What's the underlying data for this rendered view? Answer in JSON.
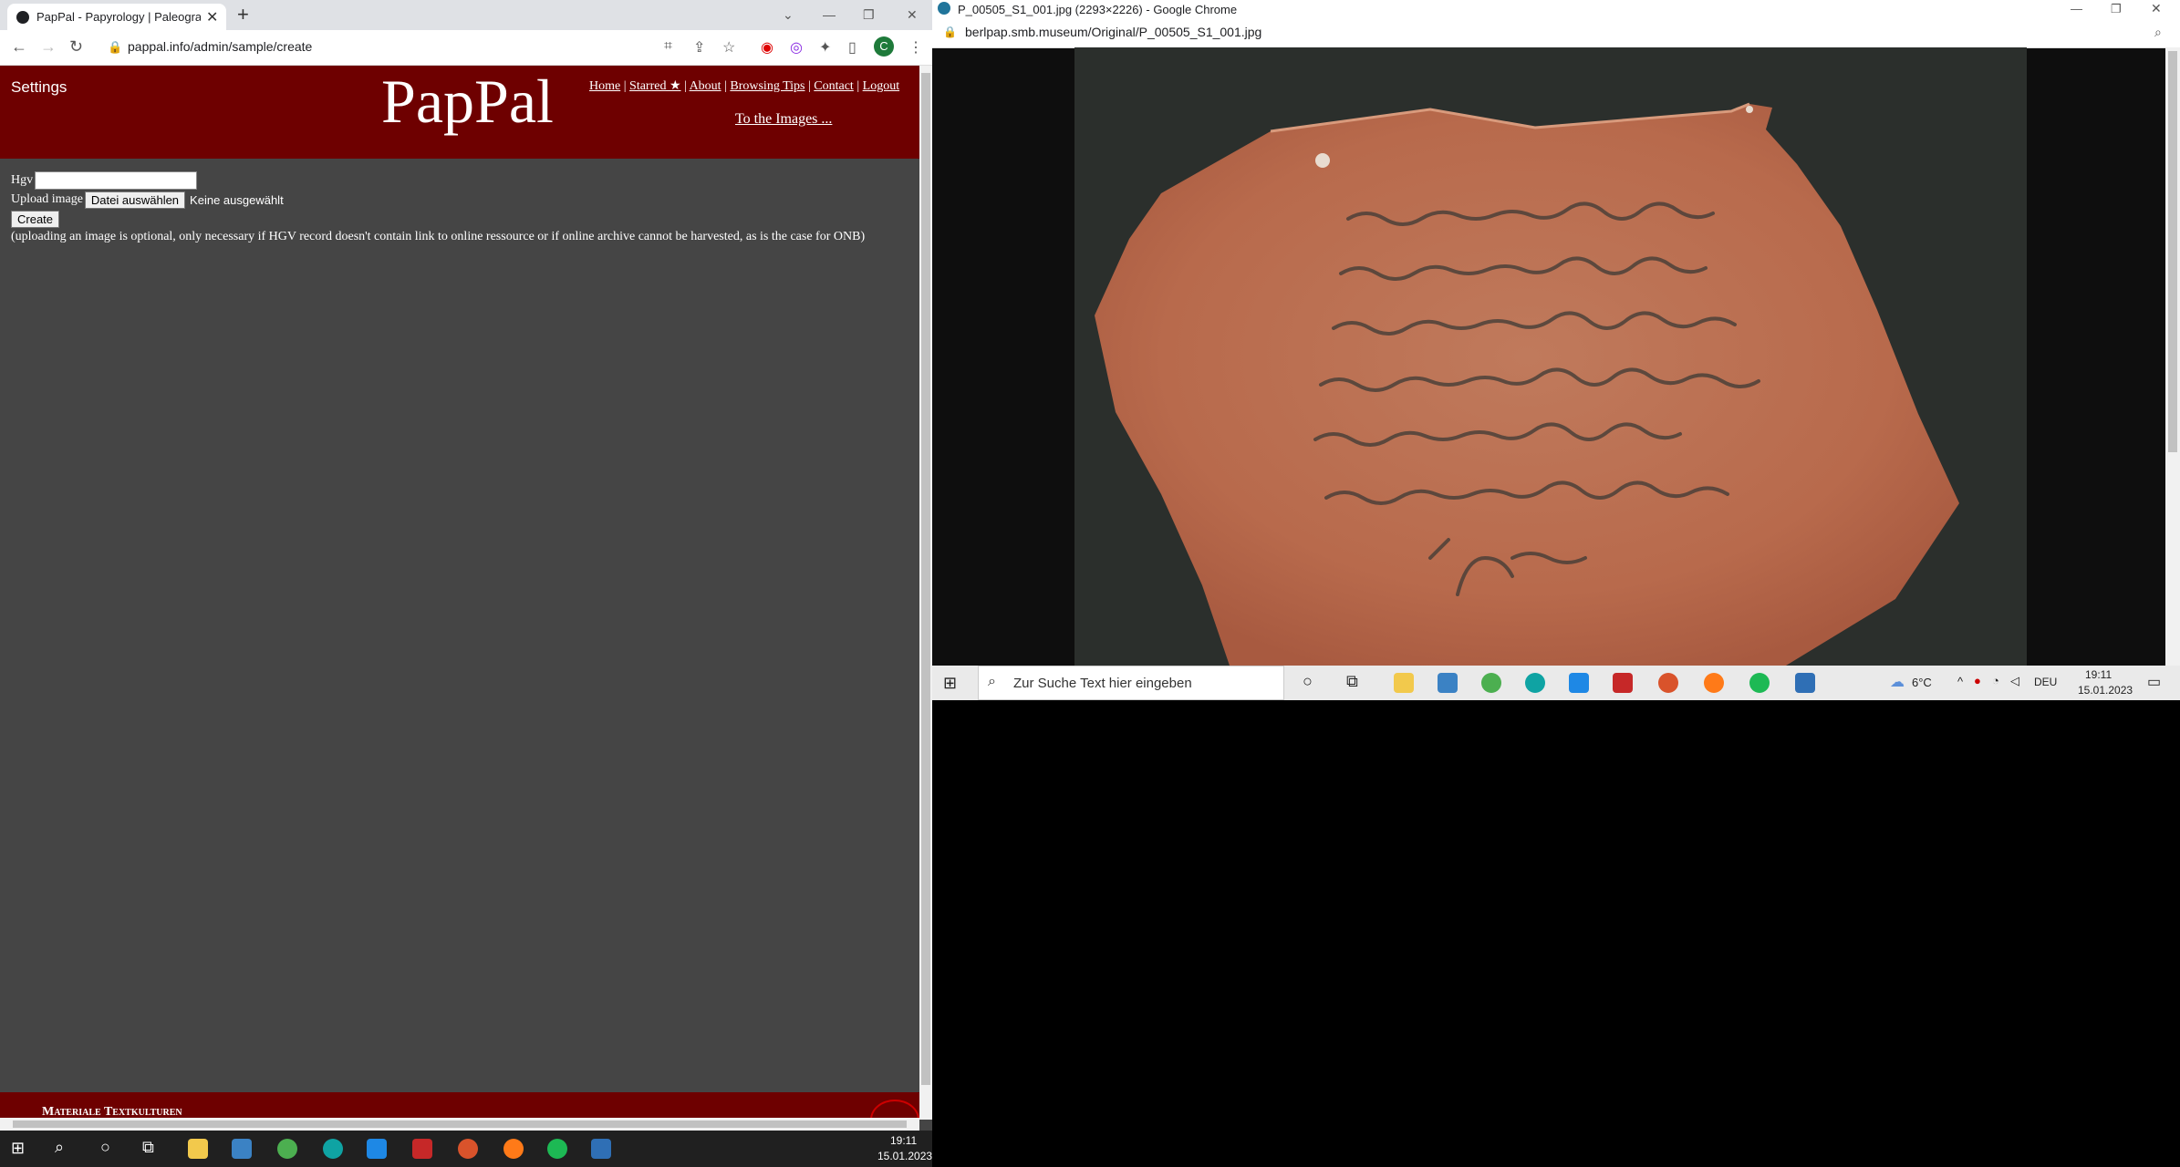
{
  "left_window": {
    "tab_title": "PapPal - Papyrology | Paleography",
    "url": "pappal.info/admin/sample/create",
    "avatar_letter": "C"
  },
  "site": {
    "settings_label": "Settings",
    "logo": "PapPal",
    "nav": [
      "Home",
      "Starred ★",
      "About",
      "Browsing Tips",
      "Contact",
      "Logout"
    ],
    "nav_separator": "|",
    "to_images": "To the Images ...",
    "form": {
      "hgv_label": "Hgv",
      "hgv_value": "",
      "upload_label": "Upload image",
      "file_button": "Datei auswählen",
      "file_status": "Keine ausgewählt",
      "create_button": "Create",
      "note": "(uploading an image is optional, only necessary if HGV record doesn't contain link to online ressource or if online archive cannot be harvested, as is the case for ONB)"
    },
    "footer": "Materiale Textkulturen"
  },
  "right_window": {
    "title": "P_00505_S1_001.jpg (2293×2226) - Google Chrome",
    "url": "berlpap.smb.museum/Original/P_00505_S1_001.jpg"
  },
  "right_taskbar": {
    "search_placeholder": "Zur Suche Text hier eingeben",
    "weather": "6°C",
    "lang": "DEU",
    "time": "19:11",
    "date": "15.01.2023"
  },
  "bottom_taskbar": {
    "time": "19:11",
    "date": "15.01.2023"
  },
  "colors": {
    "header_red": "#6e0000",
    "page_bg": "#454545"
  }
}
